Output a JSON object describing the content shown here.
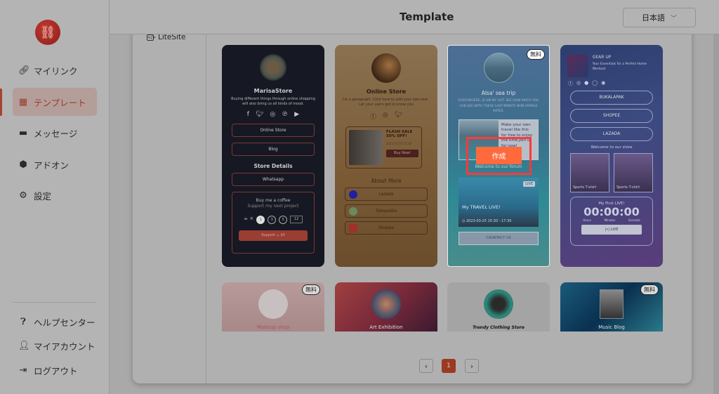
{
  "sidebar": {
    "nav": [
      {
        "label": "マイリンク",
        "icon": "link-icon"
      },
      {
        "label": "テンプレート",
        "icon": "grid-icon",
        "active": true
      },
      {
        "label": "メッセージ",
        "icon": "message-icon"
      },
      {
        "label": "アドオン",
        "icon": "addon-icon"
      },
      {
        "label": "設定",
        "icon": "gear-icon"
      }
    ],
    "bottom": [
      {
        "label": "ヘルプセンター",
        "icon": "help-icon"
      },
      {
        "label": "マイアカウント",
        "icon": "user-icon"
      },
      {
        "label": "ログアウト",
        "icon": "logout-icon"
      }
    ]
  },
  "header": {
    "title": "Template",
    "language": "日本語"
  },
  "panel": {
    "category": "LiteSite"
  },
  "badge_free": "無料",
  "create_label": "作成",
  "cards": {
    "marisa": {
      "name": "MarisaStore",
      "desc": "Buying different things through online shopping will also bring us all kinds of mood.",
      "links": [
        "Online Store",
        "Blog"
      ],
      "section": "Store Details",
      "whatsapp": "Whatsapp",
      "coffee_title": "Buy me a coffee",
      "coffee_sub": "Support my next project",
      "qty": [
        "1",
        "3",
        "5",
        "12"
      ],
      "support": "Support ☕ $5"
    },
    "online": {
      "name": "Online Store",
      "desc": "I'm a paragraph. Click here to add your own text . Let your users get to know you",
      "sale_title": "FLASH SALE 50% OFF!",
      "sale_date": "2023-03-25 15:30",
      "buy": "Buy Now!",
      "about": "About More",
      "links": [
        "Lazada",
        "Tokopedia",
        "Shopee"
      ]
    },
    "alsa": {
      "name": "Alsa' sea trip",
      "desc": "EVERYWHERE, IS ON MY LIST. SEE HOW MUCH YOU CAN SEE WITH THESE LAST-MINUTE BON VOYAGE RATES.",
      "promo": "Make your own travel like this for free to enjoy the time.Join us for now!",
      "forum": "Welcome to our forum",
      "live_badge": "LIVE",
      "live_title": "My TRAVEL LIVE!",
      "live_time": "2023-03-25 15:30 - 17:30",
      "contact": "CAONTACT US"
    },
    "gear": {
      "name": "GEAR UP",
      "desc": "Your Essentials for a Perfect Home Workout",
      "links": [
        "BUKALAPAK",
        "SHOPEE",
        "LAZADA"
      ],
      "welcome": "Welcome to our store",
      "products": [
        "Sports T-shirt",
        "Sports T-shirt"
      ],
      "live_title": "My First LIVE!",
      "timer": "00:00:00",
      "timer_units": [
        "Hours",
        "Minutes",
        "Seconds"
      ],
      "live_btn": "|•| LIVE"
    }
  },
  "row2": [
    {
      "name": "Makeup shop",
      "free": true
    },
    {
      "name": "Art Exhibition",
      "free": false
    },
    {
      "name": "Trendy Clothing Store",
      "free": false
    },
    {
      "name": "Music Blog",
      "free": true
    }
  ],
  "pagination": {
    "prev": "‹",
    "current": "1",
    "next": "›"
  }
}
